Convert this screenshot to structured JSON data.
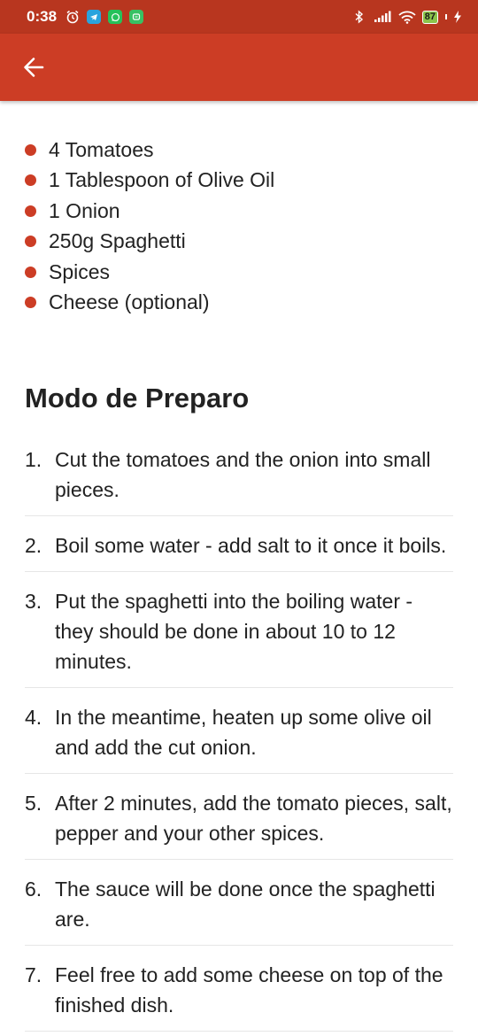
{
  "status_bar": {
    "time": "0:38",
    "battery": "87",
    "icons": [
      "alarm-icon",
      "telegram-icon",
      "whatsapp-icon",
      "app-icon",
      "bluetooth-icon",
      "signal-icon",
      "wifi-icon",
      "battery-icon",
      "charging-icon"
    ]
  },
  "app_bar": {
    "back_icon": "arrow-left-icon",
    "color": "#cc3d25"
  },
  "ingredients": [
    "4 Tomatoes",
    "1 Tablespoon of Olive Oil",
    "1 Onion",
    "250g Spaghetti",
    "Spices",
    "Cheese (optional)"
  ],
  "preparation": {
    "title": "Modo de Preparo",
    "steps": [
      {
        "number": "1.",
        "text": "Cut the tomatoes and the onion into small pieces."
      },
      {
        "number": "2.",
        "text": "Boil some water - add salt to it once it boils."
      },
      {
        "number": "3.",
        "text": "Put the spaghetti into the boiling water - they should be done in about 10 to 12 minutes."
      },
      {
        "number": "4.",
        "text": "In the meantime, heaten up some olive oil and add the cut onion."
      },
      {
        "number": "5.",
        "text": "After 2 minutes, add the tomato pieces, salt, pepper and your other spices."
      },
      {
        "number": "6.",
        "text": "The sauce will be done once the spaghetti are."
      },
      {
        "number": "7.",
        "text": "Feel free to add some cheese on top of the finished dish."
      }
    ]
  }
}
